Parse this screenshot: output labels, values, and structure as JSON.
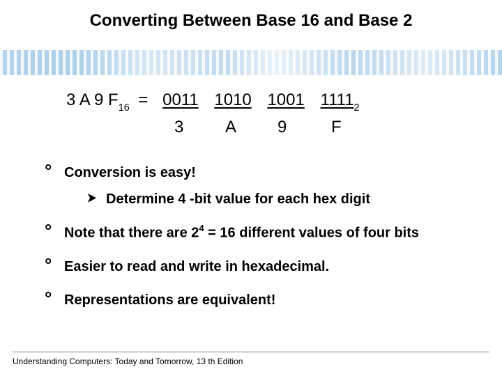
{
  "title": "Converting Between Base 16 and Base 2",
  "conversion": {
    "hex_value": "3 A 9 F",
    "hex_base": "16",
    "eq": "=",
    "groups": [
      "0011",
      "1010",
      "1001",
      "1111"
    ],
    "bin_base": "2",
    "hex_digits": [
      "3",
      "A",
      "9",
      "F"
    ]
  },
  "bullets": {
    "b1": "Conversion is easy!",
    "sub1": "Determine 4 -bit value for each hex digit",
    "b2_pre": "Note that there are 2",
    "b2_exp": "4",
    "b2_post": " = 16 different values of four bits",
    "b3": "Easier to read and write in hexadecimal.",
    "b4": "Representations are equivalent!"
  },
  "footer": "Understanding Computers: Today and Tomorrow, 13 th Edition"
}
